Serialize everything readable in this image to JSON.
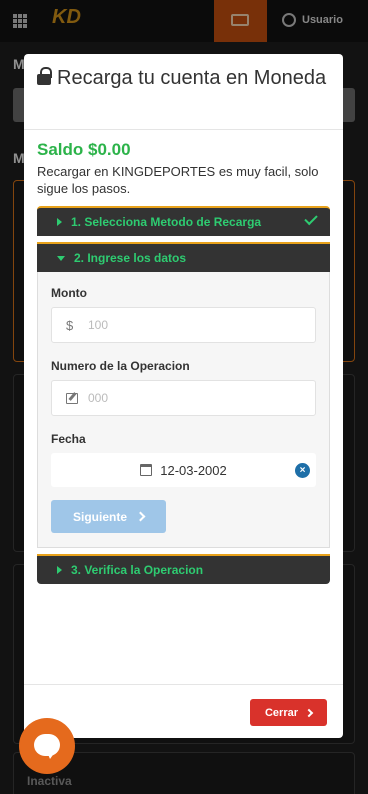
{
  "background": {
    "user_label": "Usuario",
    "section1_label": "M",
    "section2_label": "M",
    "inactive_label": "Inactiva"
  },
  "modal": {
    "title": "Recarga tu cuenta en Moneda",
    "saldo": "Saldo $0.00",
    "description": "Recargar en KINGDEPORTES es muy facil, solo sigue los pasos.",
    "steps": [
      {
        "label": "1. Selecciona Metodo de Recarga",
        "completed": true
      },
      {
        "label": "2. Ingrese los datos",
        "expanded": true
      },
      {
        "label": "3. Verifica la Operacion"
      }
    ],
    "form": {
      "monto_label": "Monto",
      "monto_prefix": "$",
      "monto_placeholder": "100",
      "operacion_label": "Numero de la Operacion",
      "operacion_placeholder": "000",
      "fecha_label": "Fecha",
      "fecha_value": "12-03-2002",
      "siguiente_label": "Siguiente"
    },
    "close_label": "Cerrar"
  },
  "colors": {
    "accent_green": "#2ecc71",
    "saldo_green": "#2cb34a",
    "step_border_orange": "#e8a21b",
    "close_red": "#d9322b",
    "siguiente_blue": "#9fc6e8",
    "chat_orange": "#e56a1d"
  }
}
